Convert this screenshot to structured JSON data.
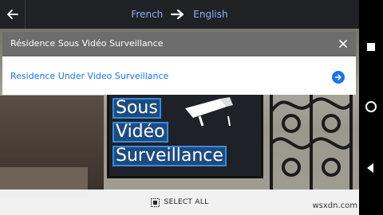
{
  "header": {
    "source_language": "French",
    "target_language": "English",
    "back_icon": "arrow-left-icon",
    "swap_icon": "arrow-right-icon"
  },
  "source": {
    "text": "Résidence Sous Vidéo Surveillance",
    "close_icon": "close-icon"
  },
  "result": {
    "text": "Residence Under Video Surveillance",
    "go_icon": "arrow-right-circle-icon"
  },
  "camera_text": {
    "line1": "Sous",
    "line2": "Vidéo",
    "line3": "Surveillance"
  },
  "bottom": {
    "select_all_label": "SELECT ALL",
    "select_all_icon": "select-all-icon"
  },
  "watermark": "wsxdn.com",
  "navbar": {
    "items": [
      "square-recents-icon",
      "circle-home-icon",
      "triangle-back-icon"
    ]
  },
  "colors": {
    "accent": "#1a73e8",
    "lang_link": "#8ab4f8",
    "topbar": "#202124",
    "source_panel": "#6d6d6d"
  }
}
